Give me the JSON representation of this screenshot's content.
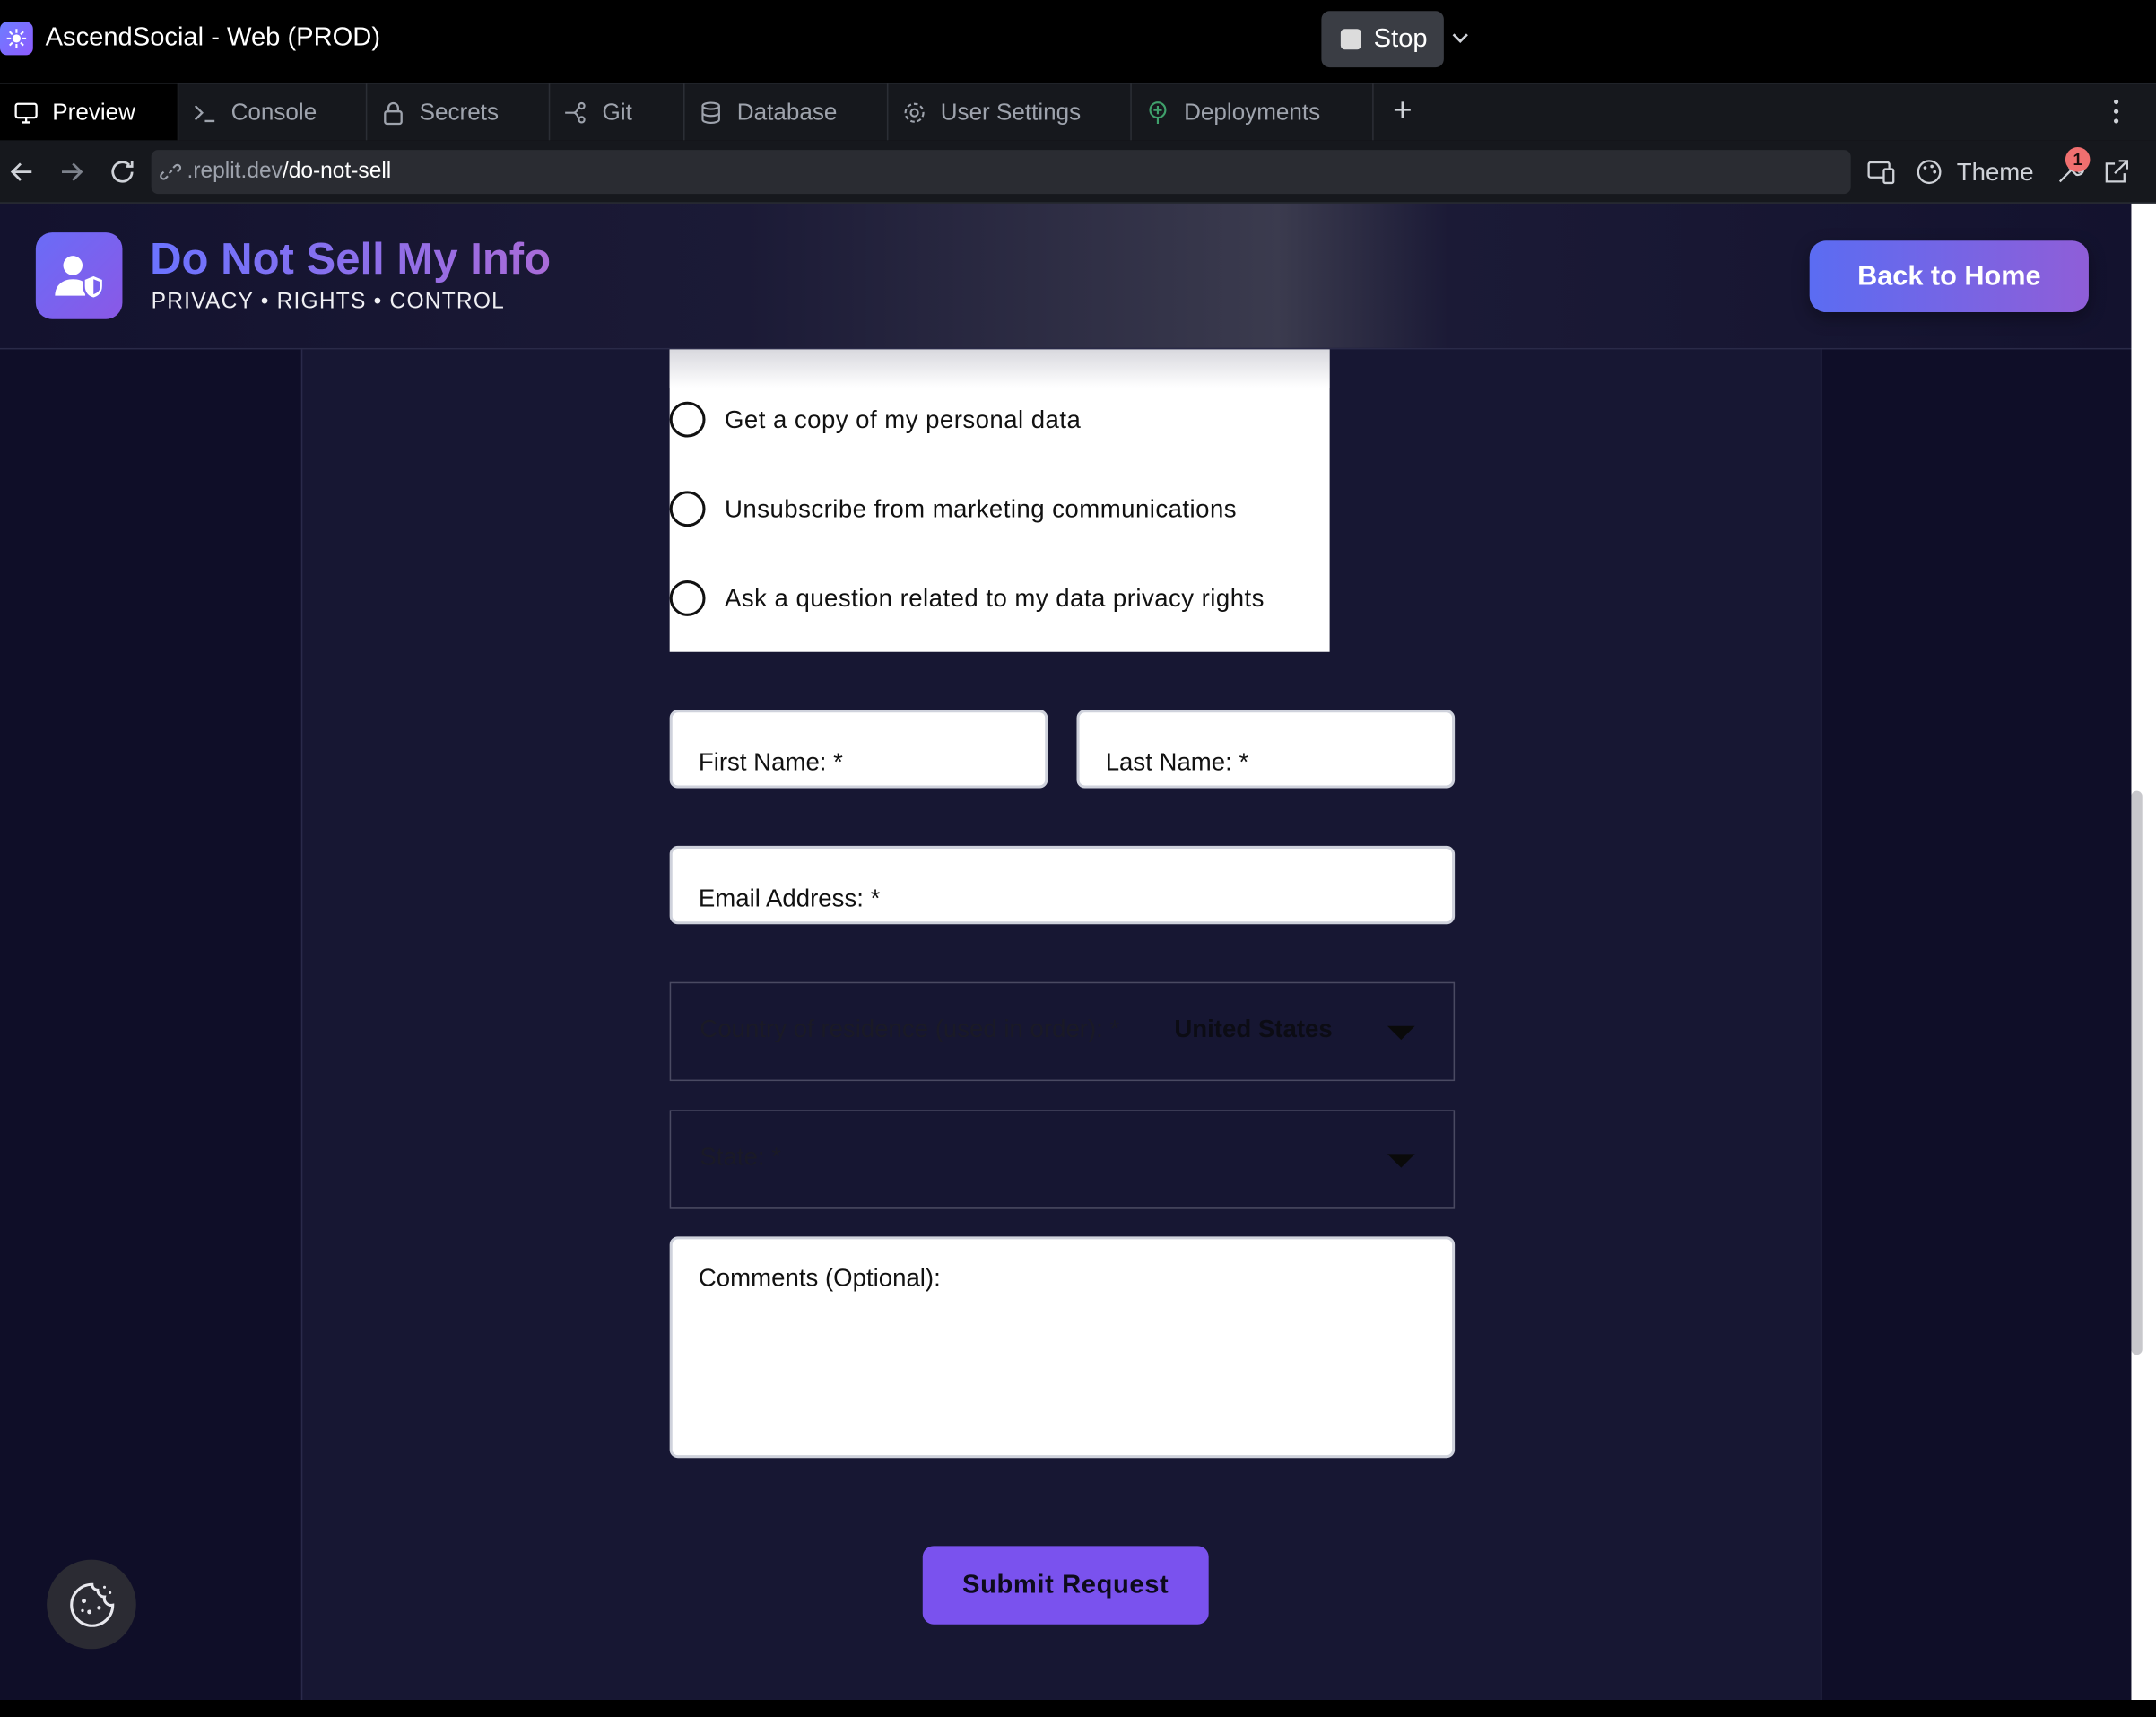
{
  "window": {
    "title": "AscendSocial - Web (PROD)",
    "stop_label": "Stop"
  },
  "tabs": [
    {
      "label": "Preview",
      "icon": "monitor-icon"
    },
    {
      "label": "Console",
      "icon": "terminal-icon"
    },
    {
      "label": "Secrets",
      "icon": "lock-icon"
    },
    {
      "label": "Git",
      "icon": "git-icon"
    },
    {
      "label": "Database",
      "icon": "database-icon"
    },
    {
      "label": "User Settings",
      "icon": "gear-icon"
    },
    {
      "label": "Deployments",
      "icon": "deploy-icon"
    }
  ],
  "urlbar": {
    "host": ".replit.dev",
    "path": "/do-not-sell",
    "theme_label": "Theme",
    "badge_count": "1"
  },
  "header": {
    "title": "Do Not Sell My Info",
    "subtitle": "PRIVACY • RIGHTS • CONTROL",
    "back_button": "Back to Home"
  },
  "request_options": [
    "Get a copy of my personal data",
    "Unsubscribe from marketing communications",
    "Ask a question related to my data privacy rights"
  ],
  "form": {
    "first_name_label": "First Name: *",
    "last_name_label": "Last Name: *",
    "email_label": "Email Address: *",
    "country_label": "Country of residence (used in order): *",
    "country_value": "United States",
    "state_label": "State: *",
    "comments_label": "Comments (Optional):",
    "submit_label": "Submit Request"
  },
  "colors": {
    "accent": "#7a52ee",
    "brand_gradient_start": "#6b73ff",
    "brand_gradient_end": "#a96bd8",
    "background": "#0f0e28"
  }
}
